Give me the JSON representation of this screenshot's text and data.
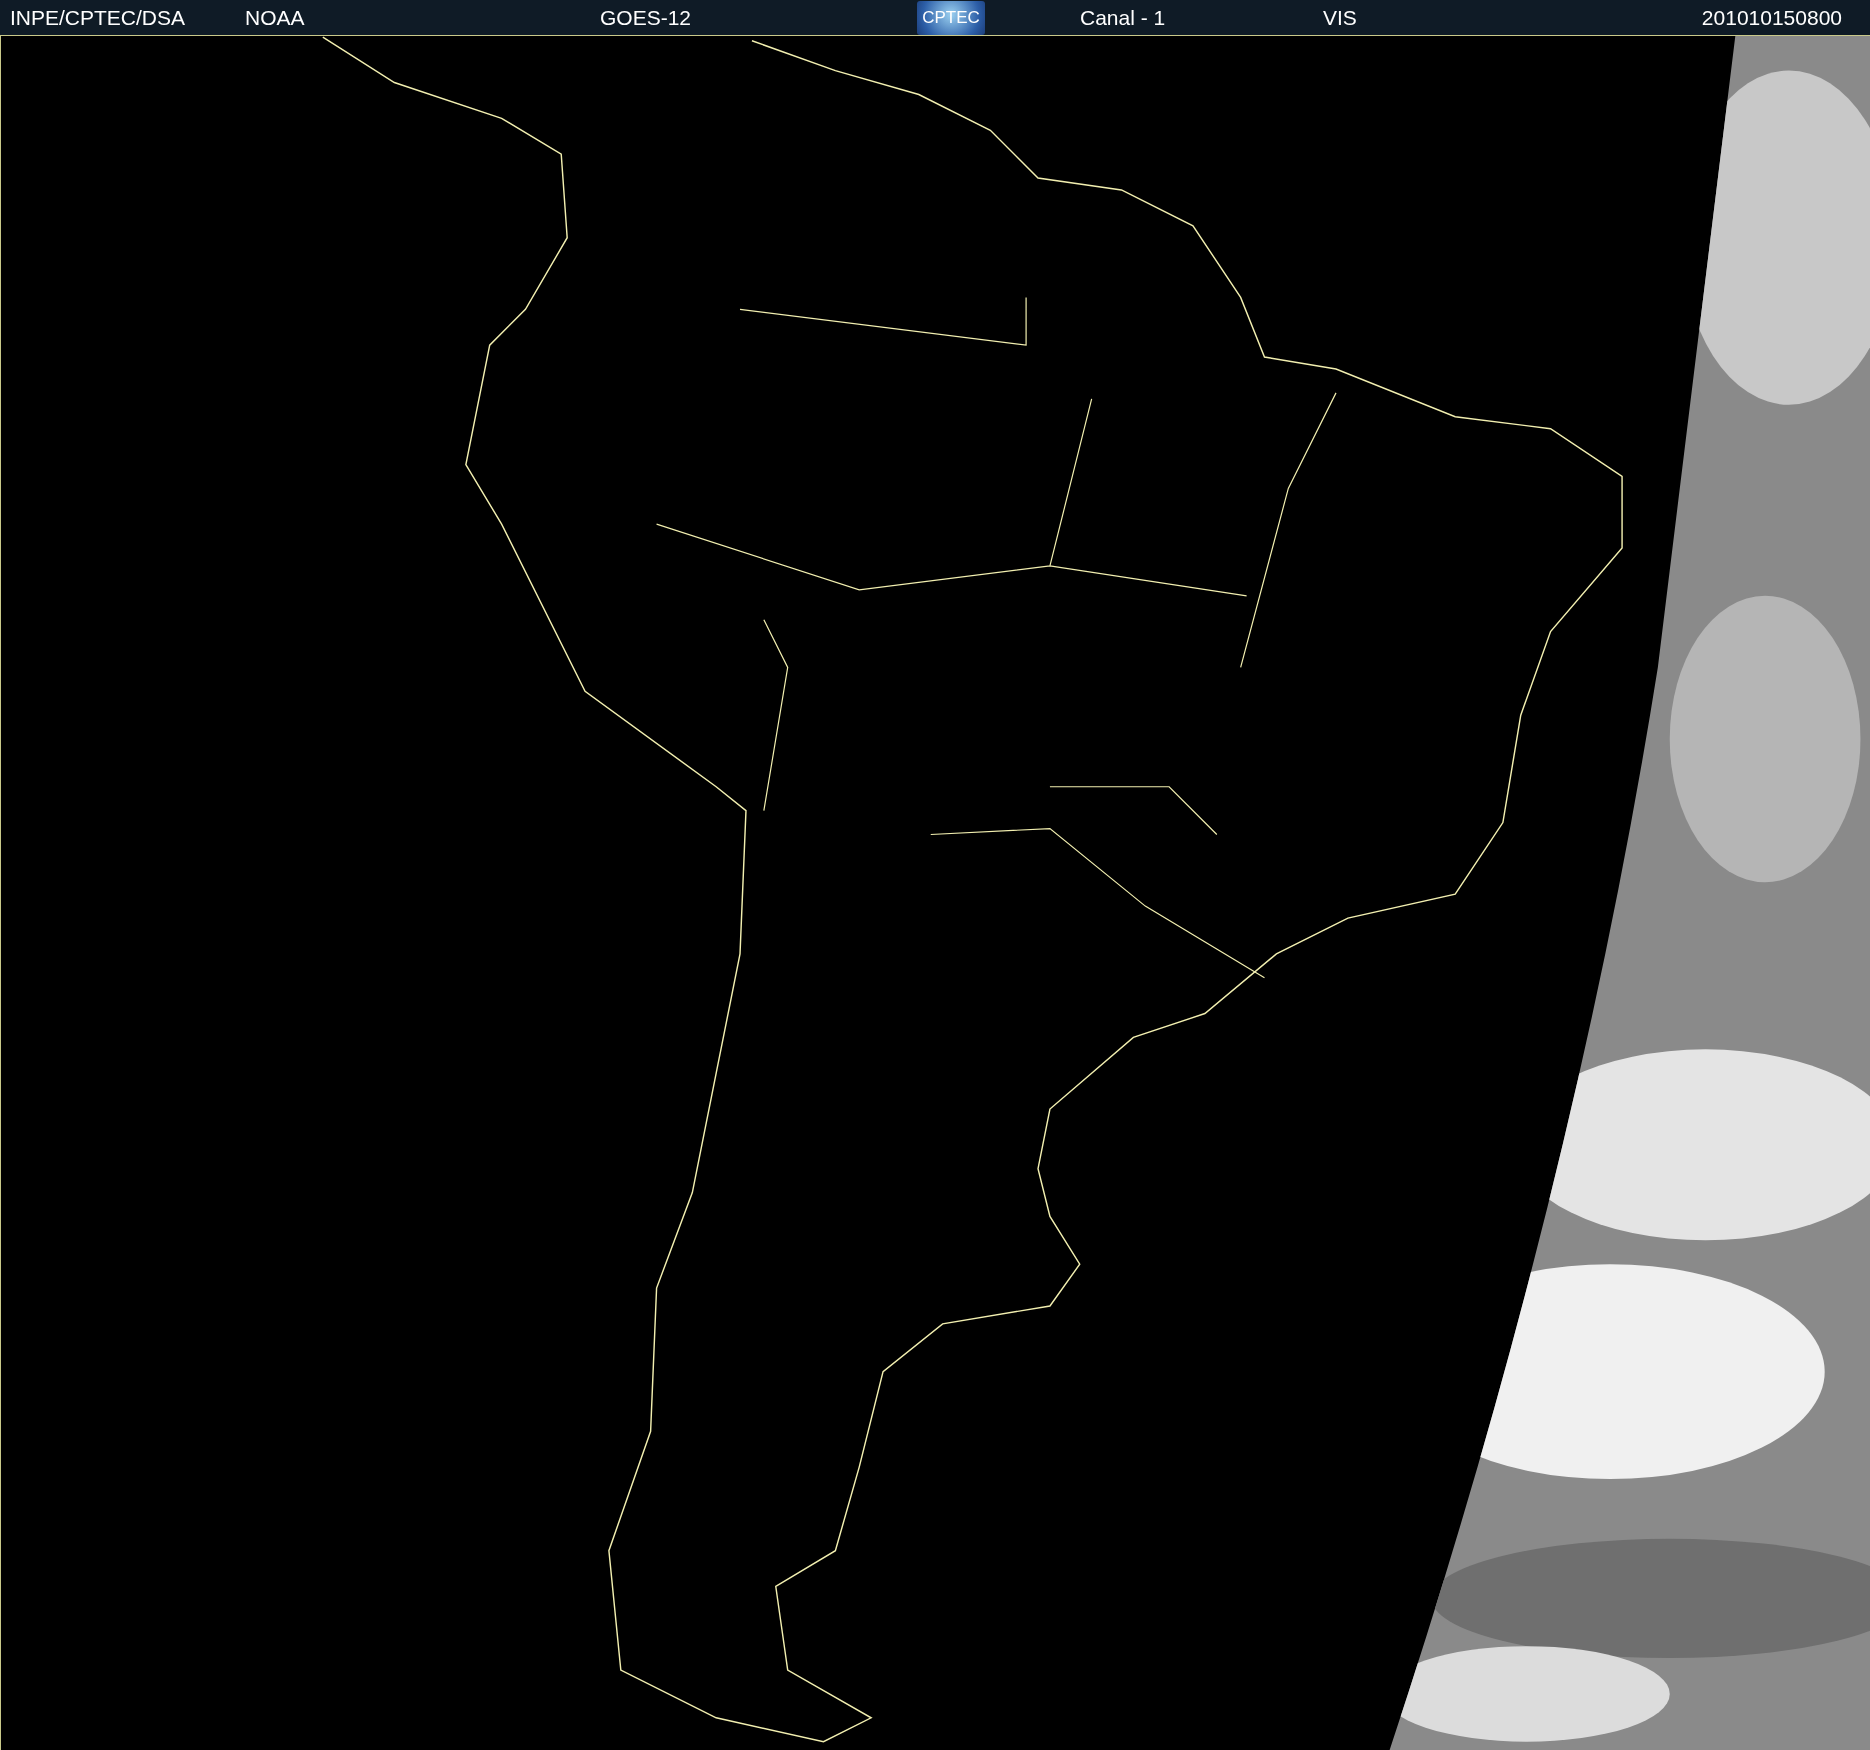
{
  "header": {
    "items": [
      {
        "kind": "text",
        "text": "INPE/CPTEC/DSA"
      },
      {
        "kind": "text",
        "text": "NOAA"
      },
      {
        "kind": "text",
        "text": "GOES-12"
      },
      {
        "kind": "logo",
        "text": "CPTEC"
      },
      {
        "kind": "text",
        "text": "Canal - 1"
      },
      {
        "kind": "text",
        "text": "VIS"
      },
      {
        "kind": "text",
        "text": "201010150800"
      }
    ]
  }
}
